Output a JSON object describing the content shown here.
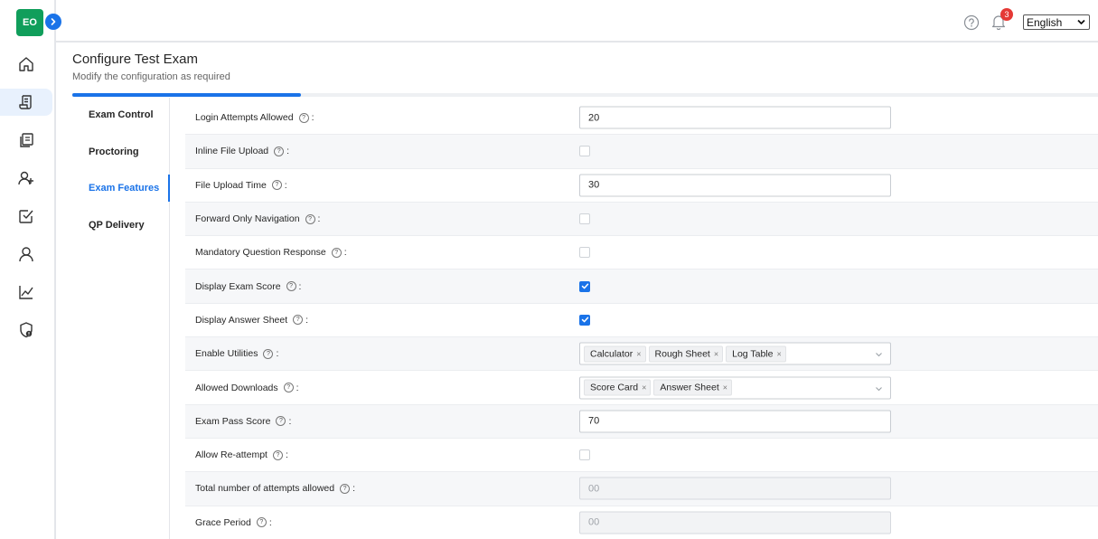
{
  "user": {
    "initials": "EO"
  },
  "nav": [
    {
      "name": "home-icon",
      "active": false
    },
    {
      "name": "exam-scroll-icon",
      "active": true
    },
    {
      "name": "documents-icon",
      "active": false
    },
    {
      "name": "add-user-icon",
      "active": false
    },
    {
      "name": "checklist-icon",
      "active": false
    },
    {
      "name": "user-icon",
      "active": false
    },
    {
      "name": "analytics-icon",
      "active": false
    },
    {
      "name": "security-shield-icon",
      "active": false
    }
  ],
  "topbar": {
    "notification_count": "3",
    "language": "English"
  },
  "header": {
    "title": "Configure Test Exam",
    "subtitle": "Modify the configuration as required",
    "progress_fraction": 0.223
  },
  "tabs": [
    {
      "label": "Exam Control",
      "active": false
    },
    {
      "label": "Proctoring",
      "active": false
    },
    {
      "label": "Exam Features",
      "active": true
    },
    {
      "label": "QP Delivery",
      "active": false
    }
  ],
  "settings": [
    {
      "label": "Login Attempts Allowed",
      "type": "input",
      "value": "20"
    },
    {
      "label": "Inline File Upload",
      "type": "checkbox",
      "checked": false
    },
    {
      "label": "File Upload Time",
      "type": "input",
      "value": "30"
    },
    {
      "label": "Forward Only Navigation",
      "type": "checkbox",
      "checked": false
    },
    {
      "label": "Mandatory Question Response",
      "type": "checkbox",
      "checked": false
    },
    {
      "label": "Display Exam Score",
      "type": "checkbox",
      "checked": true
    },
    {
      "label": "Display Answer Sheet",
      "type": "checkbox",
      "checked": true
    },
    {
      "label": "Enable Utilities",
      "type": "multiselect",
      "tags": [
        "Calculator",
        "Rough Sheet",
        "Log Table"
      ]
    },
    {
      "label": "Allowed Downloads",
      "type": "multiselect",
      "tags": [
        "Score Card",
        "Answer Sheet"
      ]
    },
    {
      "label": "Exam Pass Score",
      "type": "input",
      "value": "70"
    },
    {
      "label": "Allow Re-attempt",
      "type": "checkbox",
      "checked": false
    },
    {
      "label": "Total number of attempts allowed",
      "type": "input-disabled",
      "value": "00"
    },
    {
      "label": "Grace Period",
      "type": "input-disabled",
      "value": "00"
    }
  ],
  "colors": {
    "accent": "#1a73e8",
    "avatar": "#109e5b",
    "badge": "#e53935"
  }
}
